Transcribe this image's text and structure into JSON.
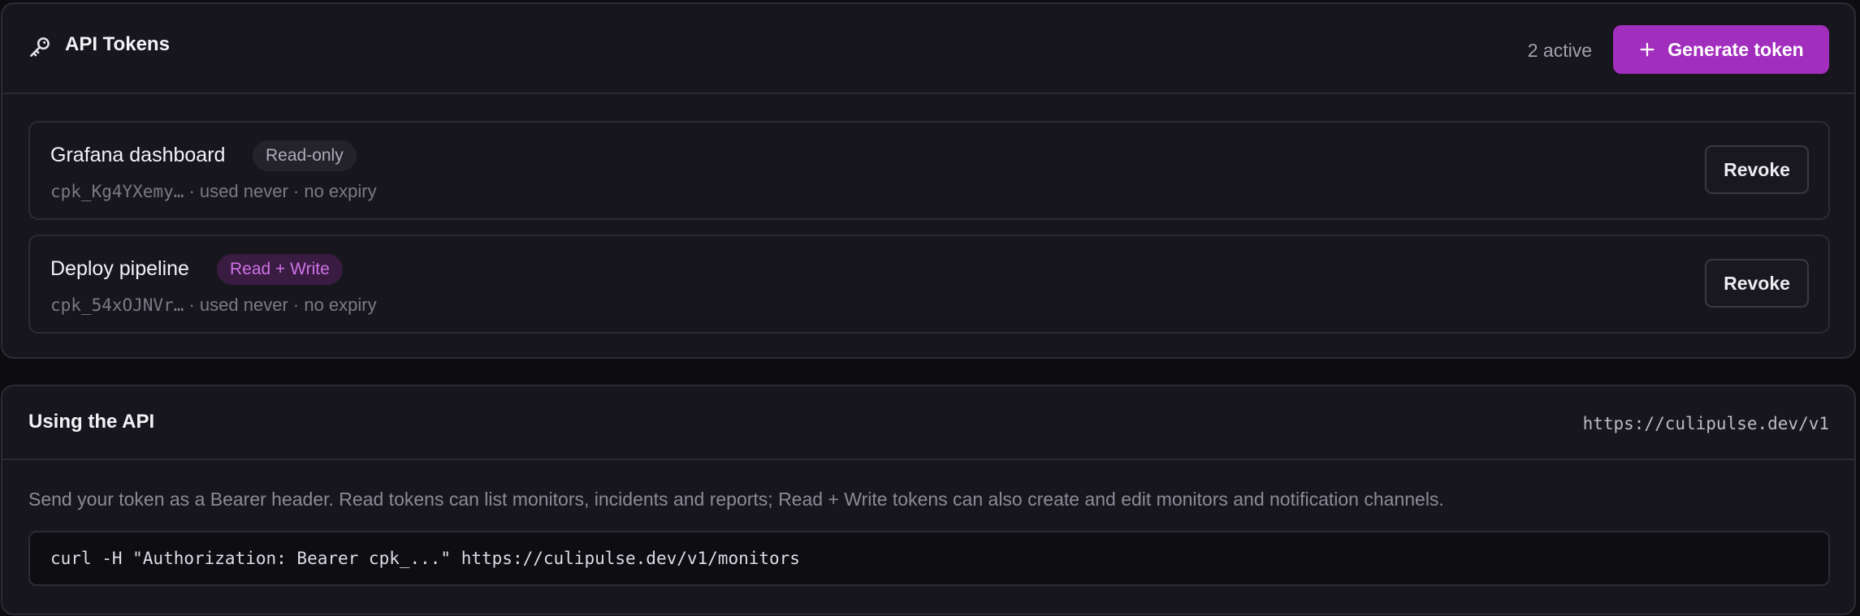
{
  "tokens_panel": {
    "title": "API Tokens",
    "active_count": "2 active",
    "generate_label": "Generate token",
    "tokens": [
      {
        "name": "Grafana dashboard",
        "scope": "Read-only",
        "prefix": "cpk_Kg4YXemy…",
        "meta": " · used never · no expiry",
        "revoke_label": "Revoke"
      },
      {
        "name": "Deploy pipeline",
        "scope": "Read + Write",
        "prefix": "cpk_54xOJNVr…",
        "meta": " · used never · no expiry",
        "revoke_label": "Revoke"
      }
    ]
  },
  "api_panel": {
    "title": "Using the API",
    "base_url": "https://culipulse.dev/v1",
    "description": "Send your token as a Bearer header. Read tokens can list monitors, incidents and reports; Read + Write tokens can also create and edit monitors and notification channels.",
    "example_command": "curl -H \"Authorization: Bearer cpk_...\" https://culipulse.dev/v1/monitors"
  },
  "colors": {
    "accent": "#a22ebd",
    "read_write_badge_text": "#cf72e6",
    "background": "#0d0d11",
    "card": "#17161d"
  },
  "icons": {
    "header": "key-icon",
    "generate": "plus-icon"
  }
}
